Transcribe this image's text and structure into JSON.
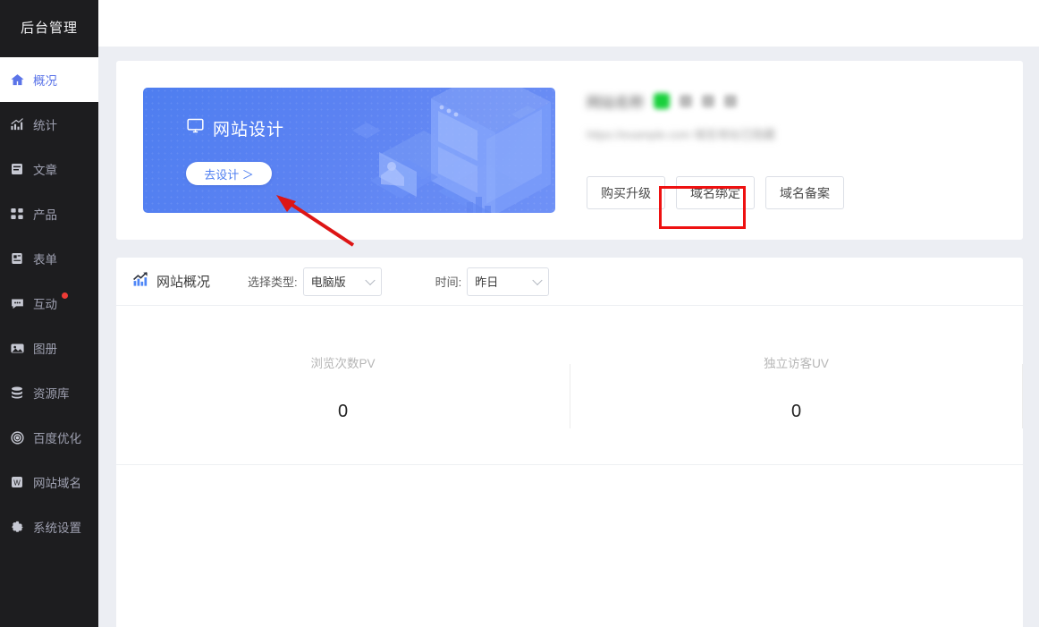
{
  "sidebar": {
    "brand": "后台管理",
    "items": [
      {
        "label": "概况",
        "icon": "home-icon",
        "active": true,
        "badge": false
      },
      {
        "label": "统计",
        "icon": "chart-icon",
        "active": false,
        "badge": false
      },
      {
        "label": "文章",
        "icon": "article-icon",
        "active": false,
        "badge": false
      },
      {
        "label": "产品",
        "icon": "grid-icon",
        "active": false,
        "badge": false
      },
      {
        "label": "表单",
        "icon": "form-icon",
        "active": false,
        "badge": false
      },
      {
        "label": "互动",
        "icon": "chat-icon",
        "active": false,
        "badge": true
      },
      {
        "label": "图册",
        "icon": "image-icon",
        "active": false,
        "badge": false
      },
      {
        "label": "资源库",
        "icon": "database-icon",
        "active": false,
        "badge": false
      },
      {
        "label": "百度优化",
        "icon": "target-icon",
        "active": false,
        "badge": false
      },
      {
        "label": "网站域名",
        "icon": "w-badge-icon",
        "active": false,
        "badge": false
      },
      {
        "label": "系统设置",
        "icon": "gear-icon",
        "active": false,
        "badge": false
      }
    ]
  },
  "banner": {
    "icon": "monitor-icon",
    "title": "网站设计",
    "button_label": "去设计 ＞"
  },
  "site_info": {
    "name_redacted": "网站名称",
    "status_badge": "online",
    "url_redacted": "https://example.com  域名地址已隐藏",
    "buttons": [
      {
        "label": "购买升级",
        "highlighted": false
      },
      {
        "label": "域名绑定",
        "highlighted": true
      },
      {
        "label": "域名备案",
        "highlighted": false
      }
    ]
  },
  "overview": {
    "icon": "trend-chart-icon",
    "title": "网站概况",
    "type_filter": {
      "label": "选择类型:",
      "value": "电脑版"
    },
    "time_filter": {
      "label": "时间:",
      "value": "昨日"
    },
    "metrics": [
      {
        "label": "浏览次数PV",
        "value": "0"
      },
      {
        "label": "独立访客UV",
        "value": "0"
      }
    ]
  },
  "annotations": {
    "highlight_color": "#ee1111",
    "rect_target": "域名绑定",
    "arrow_target": "去设计 ＞"
  }
}
